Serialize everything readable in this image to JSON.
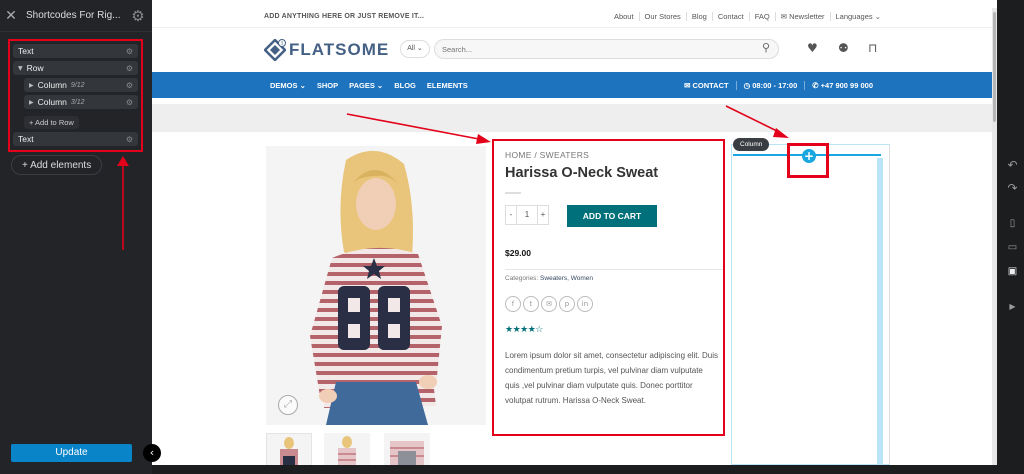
{
  "sidebar": {
    "close_icon": "✕",
    "title": "Shortcodes For Rig...",
    "gear_icon": "⚙",
    "tree": {
      "text1": "Text",
      "row": "Row",
      "col1": "Column",
      "col1_size": "9/12",
      "col2": "Column",
      "col2_size": "3/12",
      "add_to_row": "+ Add to Row",
      "text2": "Text"
    },
    "add_elements": "+ Add elements",
    "update": "Update",
    "collapse_icon": "‹"
  },
  "right_tools": {
    "undo": "↶",
    "redo": "↷",
    "mobile": "▯",
    "tablet": "▭",
    "desktop": "▣",
    "play": "▶"
  },
  "topbar": {
    "left": "ADD ANYTHING HERE OR JUST REMOVE IT...",
    "links": [
      "About",
      "Our Stores",
      "Blog",
      "Contact",
      "FAQ",
      "✉ Newsletter",
      "Languages ⌄"
    ]
  },
  "header": {
    "logo_text": "FLATSOME",
    "search_select": "All ⌄",
    "search_placeholder": "Search...",
    "search_icon": "⚲",
    "wishlist_icon": "♥",
    "account_icon": "⚉",
    "cart_icon": "⊓"
  },
  "nav": {
    "left": [
      "DEMOS ⌄",
      "SHOP",
      "PAGES ⌄",
      "BLOG",
      "ELEMENTS"
    ],
    "right": [
      "✉ CONTACT",
      "◷ 08:00 - 17:00",
      "✆ +47 900 99 000"
    ]
  },
  "product": {
    "breadcrumb": "HOME  /  SWEATERS",
    "title": "Harissa O-Neck Sweat",
    "qty_minus": "-",
    "qty_value": "1",
    "qty_plus": "+",
    "add_to_cart": "ADD TO CART",
    "price": "$29.00",
    "categories_label": "Categories: ",
    "categories": "Sweaters, Women",
    "social": [
      "f",
      "t",
      "✉",
      "p",
      "in"
    ],
    "stars": "★★★★☆",
    "rating": 4,
    "description": "Lorem ipsum dolor sit amet, consectetur adipiscing elit. Duis condimentum pretium turpis, vel pulvinar diam vulputate quis ,vel pulvinar diam vulputate quis. Donec porttitor volutpat rutrum. Harissa O-Neck Sweat.",
    "zoom_icon": "⤢"
  },
  "column": {
    "label": "Column",
    "plus": "+"
  },
  "colors": {
    "nav_blue": "#1e73be",
    "button_teal": "#00707a",
    "highlight_red": "#e2001a",
    "builder_blue": "#1aa7e0"
  }
}
